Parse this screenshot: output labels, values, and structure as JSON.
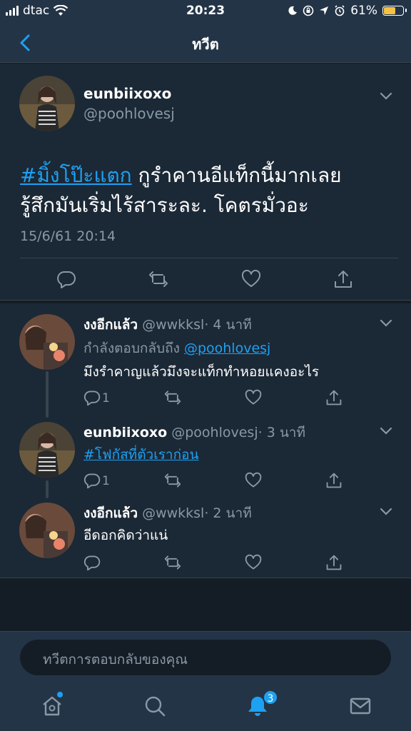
{
  "status_bar": {
    "carrier": "dtac",
    "time": "20:23",
    "battery": "61%",
    "battery_level": 0.61
  },
  "nav": {
    "title": "ทวีต"
  },
  "main_tweet": {
    "name": "eunbiixoxo",
    "handle": "@poohlovesj",
    "hashtag": "#มิ้งโป๊ะแตก",
    "text_rest": " กูรำคานอีแท็กนี้มากเลย",
    "text_line2": "รู้สึกมันเริ่มไร้สาระละ. โคตรมั่วอะ",
    "date": "15/6/61 20:14"
  },
  "replies": [
    {
      "name": "งงอีกแล้ว",
      "handle": "@wwkksl",
      "time": "· 4 นาที",
      "replying_prefix": "กำลังตอบกลับถึง",
      "replying_to": "@poohlovesj",
      "text": "มึงรำคาญแล้วมึงจะแท็กทำหอยแคงอะไร",
      "reply_count": "1"
    },
    {
      "name": "eunbiixoxo",
      "handle": "@poohlovesj",
      "time": "· 3 นาที",
      "hashtag": "#โฟกัสที่ตัวเราก่อน",
      "reply_count": "1"
    },
    {
      "name": "งงอีกแล้ว",
      "handle": "@wwkksl",
      "time": "· 2 นาที",
      "text": "อีดอกคิดว่าแน่"
    }
  ],
  "composer": {
    "placeholder": "ทวีตการตอบกลับของคุณ"
  },
  "tabs": {
    "notifications_badge": "3"
  },
  "colors": {
    "background": "#141d26",
    "card": "#1b2836",
    "bar": "#243447",
    "accent": "#1da1f2",
    "muted": "#8899a6"
  }
}
